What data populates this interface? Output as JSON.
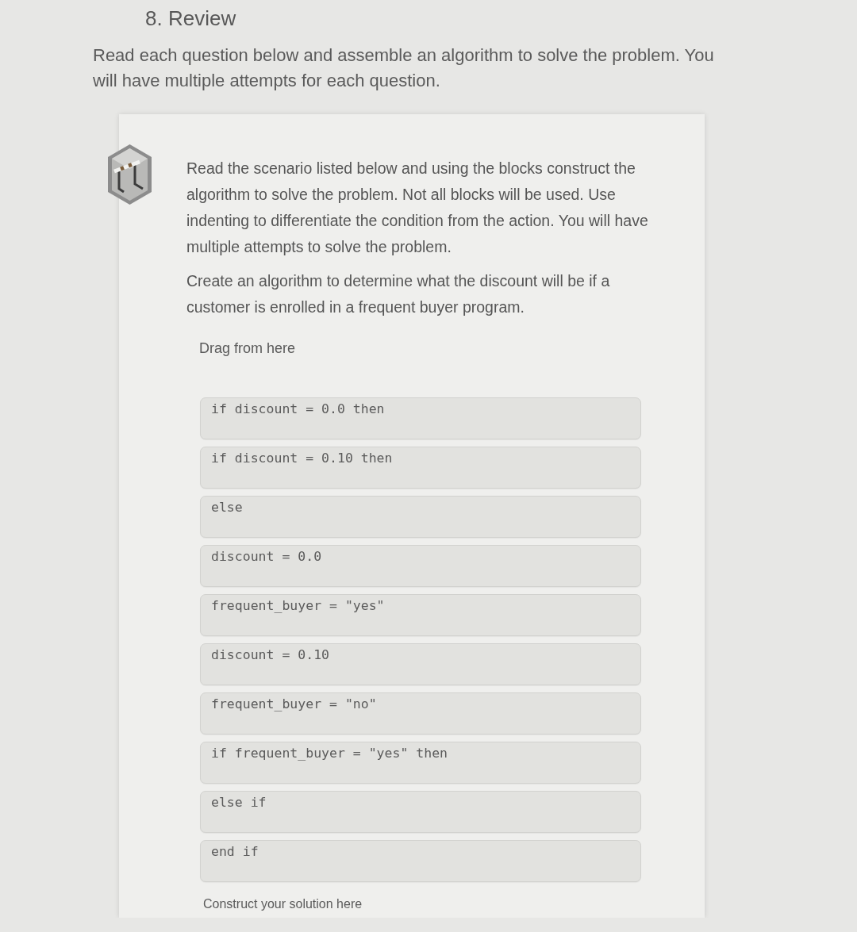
{
  "heading": "8. Review",
  "intro": "Read each question below and assemble an algorithm to solve the problem. You will have multiple attempts for each question.",
  "question": {
    "instructions": "Read the scenario listed below and using the blocks construct the algorithm to solve the problem. Not all blocks will be used. Use indenting to differentiate the condition from the action. You will have multiple attempts to solve the problem.",
    "scenario": "Create an algorithm to determine what the discount will be if a customer is enrolled in a frequent buyer program.",
    "source_label": "Drag from here",
    "blocks": [
      {
        "code": "if discount = 0.0 then"
      },
      {
        "code": "if discount = 0.10 then"
      },
      {
        "code": "else"
      },
      {
        "code": "discount = 0.0"
      },
      {
        "code": "frequent_buyer = \"yes\""
      },
      {
        "code": "discount = 0.10"
      },
      {
        "code": "frequent_buyer = \"no\""
      },
      {
        "code": "if frequent_buyer = \"yes\" then"
      },
      {
        "code": "else if"
      },
      {
        "code": "end if"
      }
    ],
    "target_label": "Construct your solution here"
  }
}
